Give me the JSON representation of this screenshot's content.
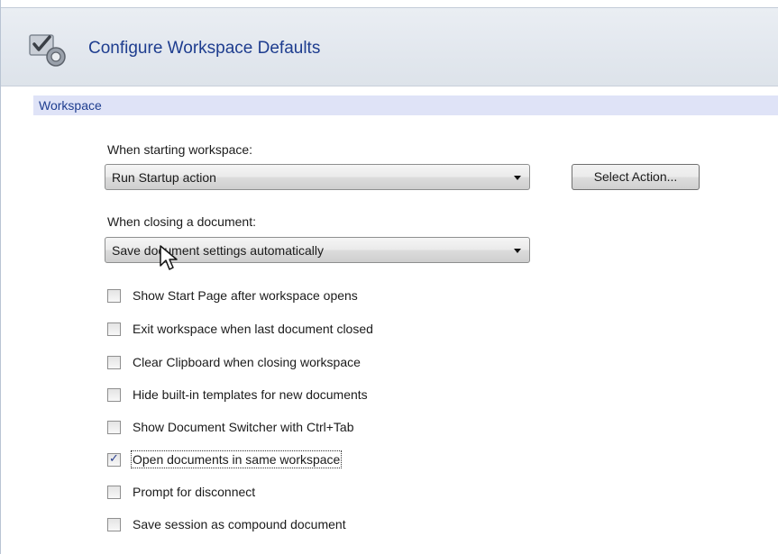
{
  "header": {
    "title": "Configure Workspace Defaults",
    "icon": "checklist-settings-icon"
  },
  "section": {
    "title": "Workspace"
  },
  "startup": {
    "label": "When starting workspace:",
    "value": "Run Startup action",
    "button_label": "Select Action..."
  },
  "closing": {
    "label": "When closing a document:",
    "value": "Save document settings automatically"
  },
  "options": [
    {
      "label": "Show Start Page after workspace opens",
      "checked": false
    },
    {
      "label": "Exit workspace when last document closed",
      "checked": false
    },
    {
      "label": "Clear Clipboard when closing workspace",
      "checked": false
    },
    {
      "label": "Hide built-in templates for new documents",
      "checked": false
    },
    {
      "label": "Show Document Switcher with Ctrl+Tab",
      "checked": false
    },
    {
      "label": "Open documents in same workspace",
      "checked": true
    },
    {
      "label": "Prompt for disconnect",
      "checked": false
    },
    {
      "label": "Save session as compound document",
      "checked": false
    }
  ],
  "colors": {
    "title_blue": "#1e3d8f",
    "section_bg": "#dfe3f7"
  }
}
